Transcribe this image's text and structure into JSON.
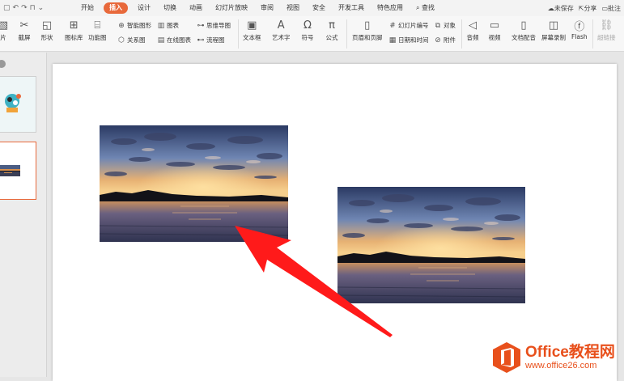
{
  "menu_tabs": [
    "开始",
    "插入",
    "设计",
    "切换",
    "动画",
    "幻灯片放映",
    "审阅",
    "视图",
    "安全",
    "开发工具",
    "特色应用"
  ],
  "active_tab": "插入",
  "search_label": "查找",
  "right_tools": {
    "save_status": "未保存",
    "share": "分享",
    "annotate": "批注"
  },
  "ribbon": {
    "picture": "片",
    "screenshot": "截屏",
    "shape": "形状",
    "icon_lib": "图标库",
    "function_chart": "功能图",
    "smart_shape": "智能图形",
    "relation_chart": "关系图",
    "chart": "图表",
    "online_chart": "在线图表",
    "mind_map": "思维导图",
    "flow_chart": "流程图",
    "textbox": "文本框",
    "wordart": "艺术字",
    "symbol": "符号",
    "formula": "公式",
    "header_footer": "页眉和页脚",
    "slide_number": "幻灯片编号",
    "object": "对象",
    "datetime": "日期和时间",
    "attachment": "附件",
    "audio": "音频",
    "video": "视频",
    "doc_dub": "文档配音",
    "screen_record": "屏幕录制",
    "flash": "Flash",
    "hyperlink": "超链接"
  },
  "watermark": {
    "brand": "Office教程网",
    "url": "www.office26.com"
  },
  "colors": {
    "accent": "#e8693b",
    "arrow": "#ff0000",
    "logo": "#e8501c"
  }
}
